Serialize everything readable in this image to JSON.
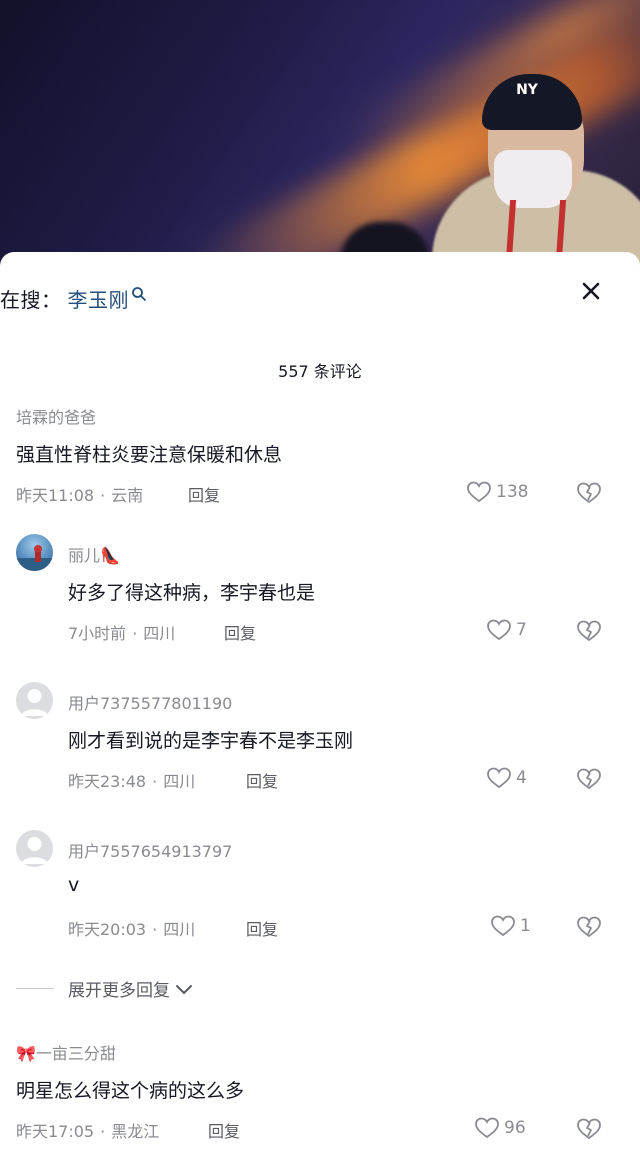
{
  "search": {
    "prefix": "在搜：",
    "term": "李玉刚"
  },
  "comment_count": "557 条评论",
  "comments": [
    {
      "username": "培霖的爸爸",
      "text": "强直性脊柱炎要注意保暖和休息",
      "time": "昨天11:08",
      "location": "云南",
      "reply": "回复",
      "likes": "138"
    },
    {
      "username": "丽儿👠",
      "text": "好多了得这种病，李宇春也是",
      "time": "7小时前",
      "location": "四川",
      "reply": "回复",
      "likes": "7"
    },
    {
      "username": "用户7375577801190",
      "text": "刚才看到说的是李宇春不是李玉刚",
      "time": "昨天23:48",
      "location": "四川",
      "reply": "回复",
      "likes": "4"
    },
    {
      "username": "用户7557654913797",
      "text": "v",
      "time": "昨天20:03",
      "location": "四川",
      "reply": "回复",
      "likes": "1"
    },
    {
      "username": "🎀一亩三分甜",
      "text": "明星怎么得这个病的这么多",
      "time": "昨天17:05",
      "location": "黑龙江",
      "reply": "回复",
      "likes": "96"
    }
  ],
  "expand_label": "展开更多回复",
  "meta_separator": "·",
  "colors": {
    "search_term": "#244f7c",
    "muted_text": "#8a8b91",
    "primary_text": "#161823"
  },
  "icons": [
    "search-icon",
    "close-icon",
    "heart-icon",
    "dislike-heart-icon",
    "chevron-down-icon",
    "default-avatar-icon"
  ]
}
